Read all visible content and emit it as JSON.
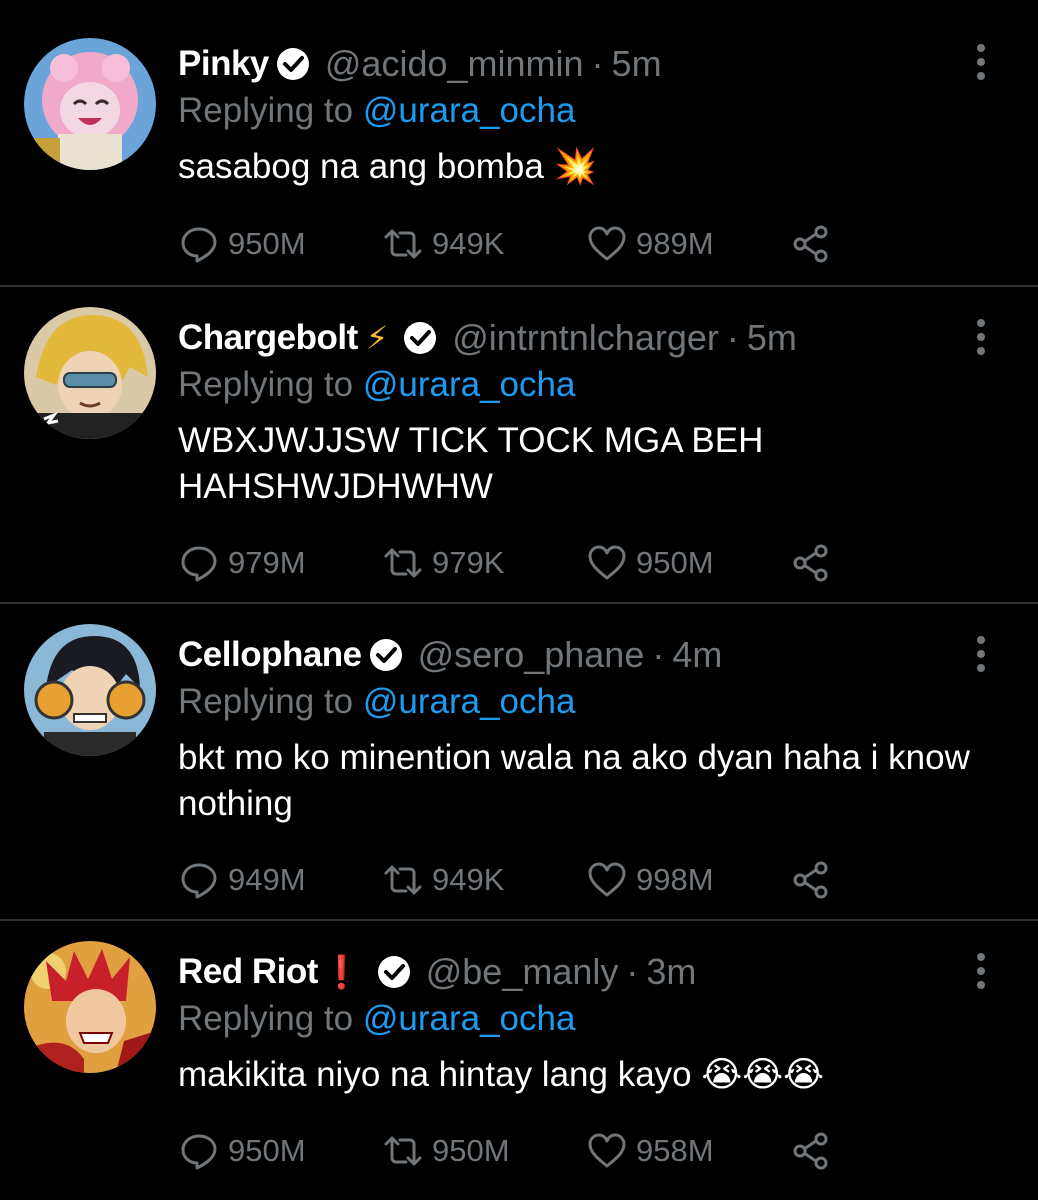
{
  "replying_prefix": "Replying to ",
  "tweets": [
    {
      "name": "Pinky",
      "name_emoji": "",
      "handle": "@acido_minmin",
      "dot": "·",
      "time": "5m",
      "replying_to": "@urara_ocha",
      "text": "sasabog na ang bomba 💥",
      "replies": "950M",
      "retweets": "949K",
      "likes": "989M",
      "avatar": "pink-hair-avatar"
    },
    {
      "name": "Chargebolt",
      "name_emoji": "⚡",
      "handle": "@intrntnlcharger",
      "dot": "·",
      "time": "5m",
      "replying_to": "@urara_ocha",
      "text": "WBXJWJJSW TICK TOCK MGA BEH HAHSHWJDHWHW",
      "replies": "979M",
      "retweets": "979K",
      "likes": "950M",
      "avatar": "blonde-hair-avatar"
    },
    {
      "name": "Cellophane",
      "name_emoji": "",
      "handle": "@sero_phane",
      "dot": "·",
      "time": "4m",
      "replying_to": "@urara_ocha",
      "text": "bkt mo ko minention wala na ako dyan haha i know nothing",
      "replies": "949M",
      "retweets": "949K",
      "likes": "998M",
      "avatar": "black-hair-avatar"
    },
    {
      "name": "Red Riot",
      "name_emoji": "❗",
      "handle": "@be_manly",
      "dot": "·",
      "time": "3m",
      "replying_to": "@urara_ocha",
      "text": "makikita niyo na hintay lang kayo 😭😭😭",
      "replies": "950M",
      "retweets": "950M",
      "likes": "958M",
      "avatar": "red-hair-avatar"
    }
  ],
  "colors": {
    "background": "#000000",
    "muted": "#71767b",
    "mention": "#1d9bf0",
    "divider": "#2f3336"
  }
}
